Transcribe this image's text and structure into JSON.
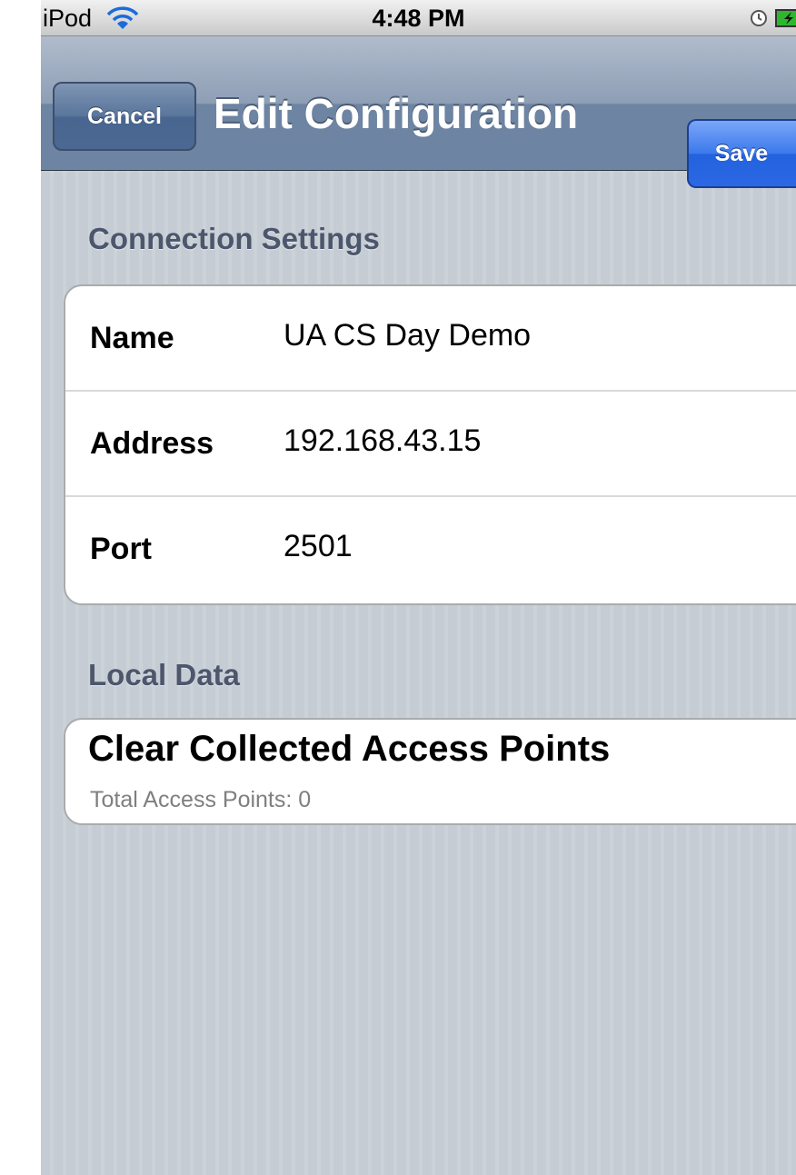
{
  "status_bar": {
    "carrier": "iPod",
    "time": "4:48 PM",
    "icons": [
      "wifi-icon",
      "alarm-icon",
      "battery-charging-icon"
    ]
  },
  "nav_bar": {
    "cancel_label": "Cancel",
    "title": "Edit Configuration",
    "save_label": "Save"
  },
  "sections": {
    "connection": {
      "header": "Connection Settings",
      "rows": [
        {
          "label": "Name",
          "value": "UA CS Day Demo"
        },
        {
          "label": "Address",
          "value": "192.168.43.15"
        },
        {
          "label": "Port",
          "value": "2501"
        }
      ]
    },
    "local_data": {
      "header": "Local Data",
      "clear_title": "Clear Collected Access Points",
      "clear_subtitle": "Total Access Points: 0"
    }
  },
  "colors": {
    "nav_bar": "#6d84a2",
    "save_button": "#2a68e4",
    "section_header": "#4c566c",
    "background_stripes": "#c5ccd4"
  }
}
